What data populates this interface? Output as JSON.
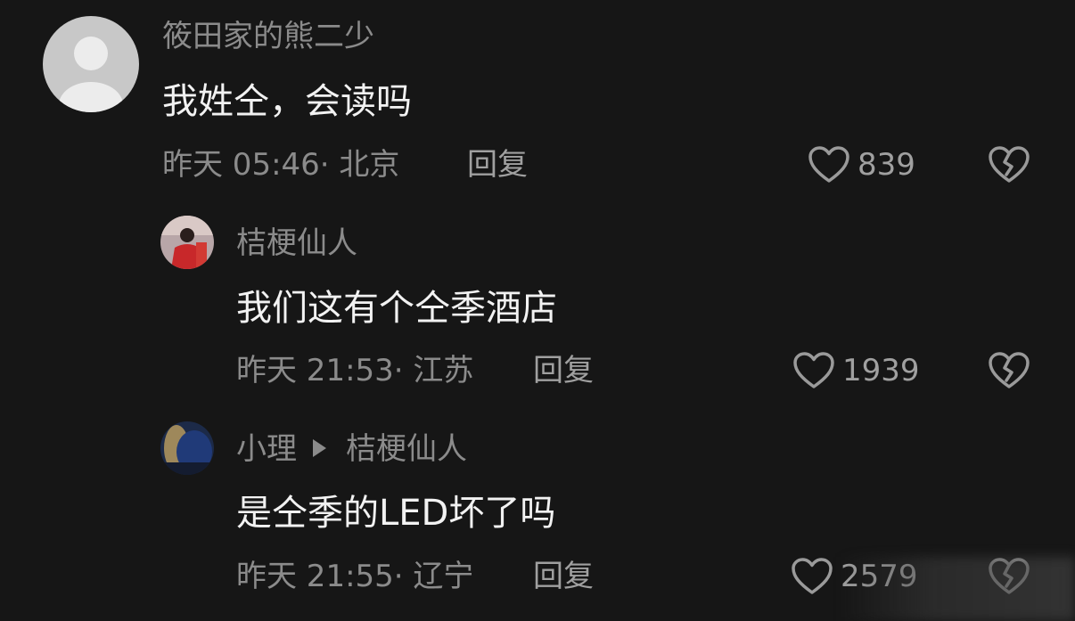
{
  "comments": [
    {
      "username": "筱田家的熊二少",
      "text": "我姓仝，会读吗",
      "meta": "昨天 05:46· 北京",
      "reply_label": "回复",
      "likes": "839"
    },
    {
      "username": "桔梗仙人",
      "text": "我们这有个仝季酒店",
      "meta": "昨天 21:53· 江苏",
      "reply_label": "回复",
      "likes": "1939"
    },
    {
      "username": "小理",
      "reply_to": "桔梗仙人",
      "text": "是仝季的LED坏了吗",
      "meta": "昨天 21:55· 辽宁",
      "reply_label": "回复",
      "likes": "2579"
    }
  ],
  "icons": {
    "like": "heart-outline-icon",
    "dislike": "broken-heart-icon",
    "reply_arrow": "triangle-right-icon"
  },
  "colors": {
    "background": "#161616",
    "secondary_text": "#8b8b8b",
    "primary_text": "#f2f2f2"
  }
}
